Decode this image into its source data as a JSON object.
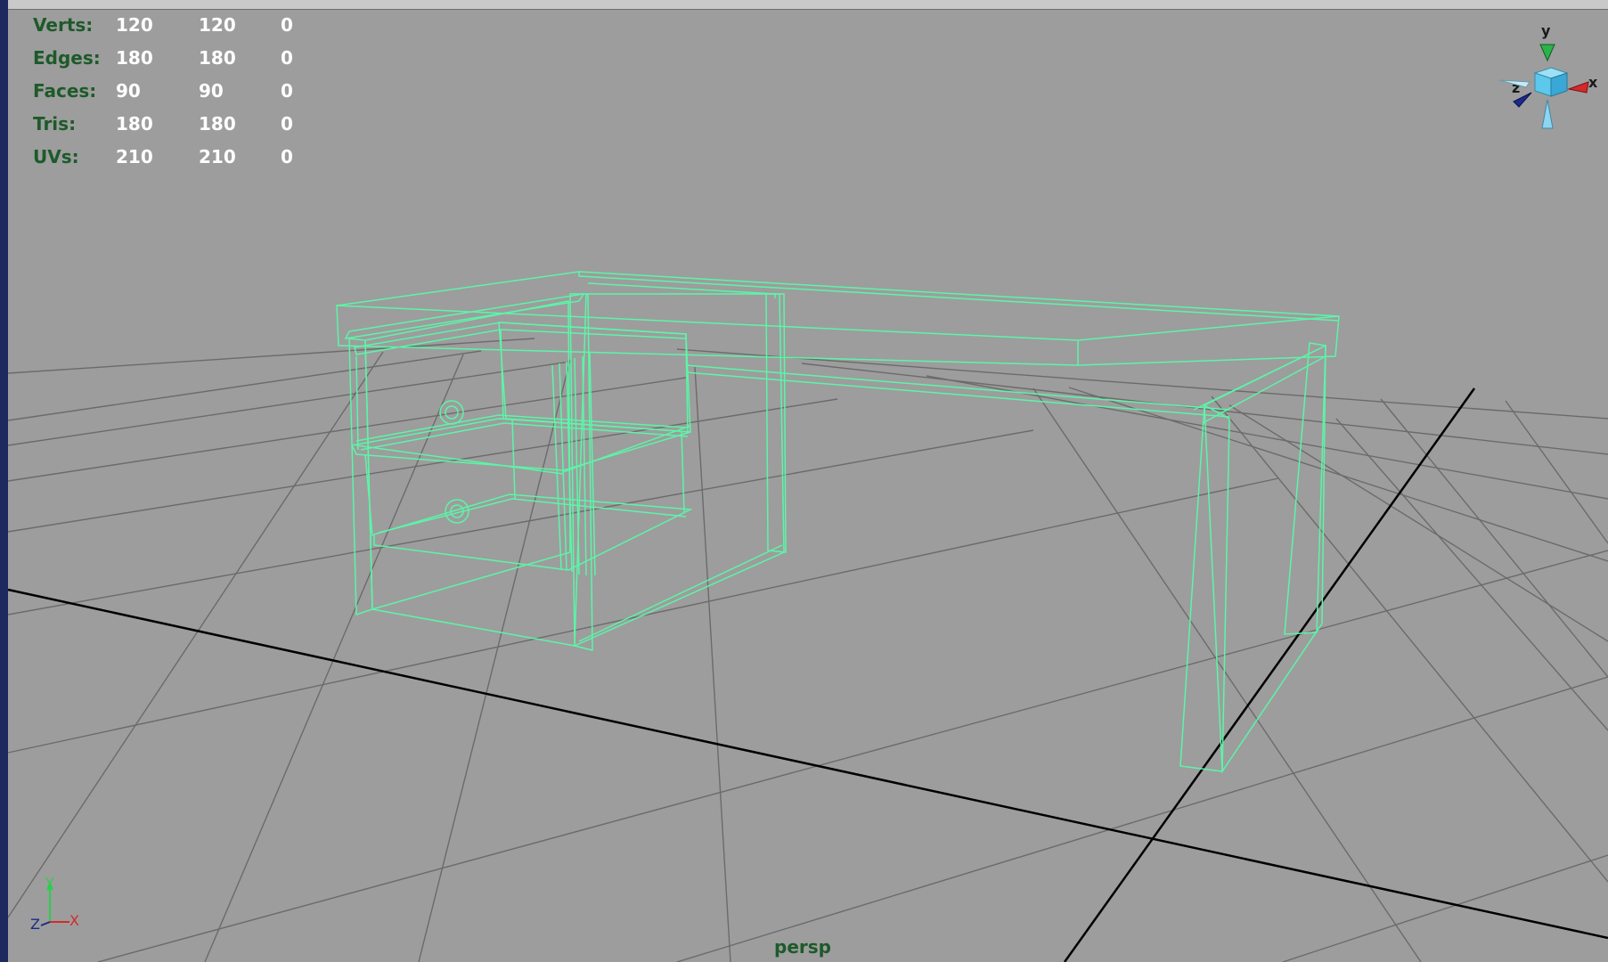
{
  "hud": {
    "rows": [
      {
        "label": "Verts:",
        "v1": "120",
        "v2": "120",
        "v3": "0"
      },
      {
        "label": "Edges:",
        "v1": "180",
        "v2": "180",
        "v3": "0"
      },
      {
        "label": "Faces:",
        "v1": "90",
        "v2": "90",
        "v3": "0"
      },
      {
        "label": "Tris:",
        "v1": "180",
        "v2": "180",
        "v3": "0"
      },
      {
        "label": "UVs:",
        "v1": "210",
        "v2": "210",
        "v3": "0"
      }
    ]
  },
  "viewport": {
    "camera_name": "persp",
    "background_color": "#9d9d9d",
    "grid_color": "#6a6a6a",
    "axis_line_color": "#000000",
    "wireframe_color": "#5cf5a8"
  },
  "view_cube": {
    "y_label": "y",
    "x_label": "x",
    "z_label": "z"
  },
  "axis_indicator": {
    "y_label": "Y",
    "x_label": "X",
    "z_label": "Z"
  }
}
